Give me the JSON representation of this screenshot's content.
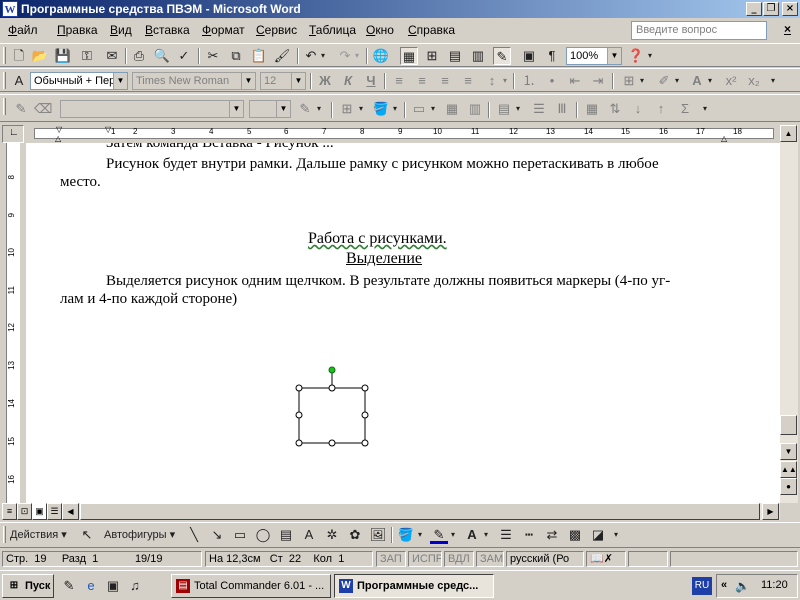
{
  "window": {
    "title": "Программные средства ПВЭМ - Microsoft Word",
    "controls": [
      "_",
      "❐",
      "×"
    ]
  },
  "menu": {
    "items": [
      "Файл",
      "Правка",
      "Вид",
      "Вставка",
      "Формат",
      "Сервис",
      "Таблица",
      "Окно",
      "Справка"
    ],
    "ask_placeholder": "Введите вопрос",
    "close": "×"
  },
  "standard_toolbar": {
    "zoom": "100%"
  },
  "formatting_toolbar": {
    "style": "Обычный + Пер",
    "font": "Times New Roman",
    "size": "12",
    "bold": "Ж",
    "italic": "К",
    "underline": "Ч"
  },
  "ruler": {
    "ticks": [
      "1",
      "2",
      "3",
      "4",
      "5",
      "6",
      "7",
      "8",
      "9",
      "10",
      "11",
      "12",
      "13",
      "14",
      "15",
      "16",
      "17",
      "18"
    ],
    "vticks": [
      "7",
      "8",
      "9",
      "10",
      "11",
      "12",
      "13",
      "14",
      "15",
      "16"
    ]
  },
  "document": {
    "partial_line": "Затем команда Вставка - Рисунок ...",
    "para1_line1": "Рисунок будет внутри рамки. Дальше рамку с рисунком можно перетаскивать в любое",
    "para1_line2": "место.",
    "heading1": "Работа с рисунками.",
    "heading2": "Выделение",
    "para2_line1": "Выделяется рисунок одним щелчком. В результате должны появиться маркеры (4-по уг-",
    "para2_line2": "лам и 4-по каждой стороне)"
  },
  "drawing_toolbar": {
    "actions": "Действия",
    "autoshapes": "Автофигуры"
  },
  "status": {
    "page": "Стр.",
    "page_num": "19",
    "section": "Разд",
    "section_num": "1",
    "pages": "19/19",
    "position": "На 12,3см",
    "line": "Ст",
    "line_num": "22",
    "column": "Кол",
    "column_num": "1",
    "rec": "ЗАП",
    "trk": "ИСПР",
    "ext": "ВДЛ",
    "ovr": "ЗАМ",
    "language": "русский (Ро"
  },
  "taskbar": {
    "start": "Пуск",
    "tasks": [
      "Total Commander 6.01 - ...",
      "Программные средс..."
    ],
    "lang": "RU",
    "clock": "11:20"
  },
  "colors": {
    "title_gradient_start": "#0a246a",
    "title_gradient_end": "#a6caf0",
    "rotation_handle": "#1ec01e",
    "spell_underline": "#2e7d32"
  }
}
